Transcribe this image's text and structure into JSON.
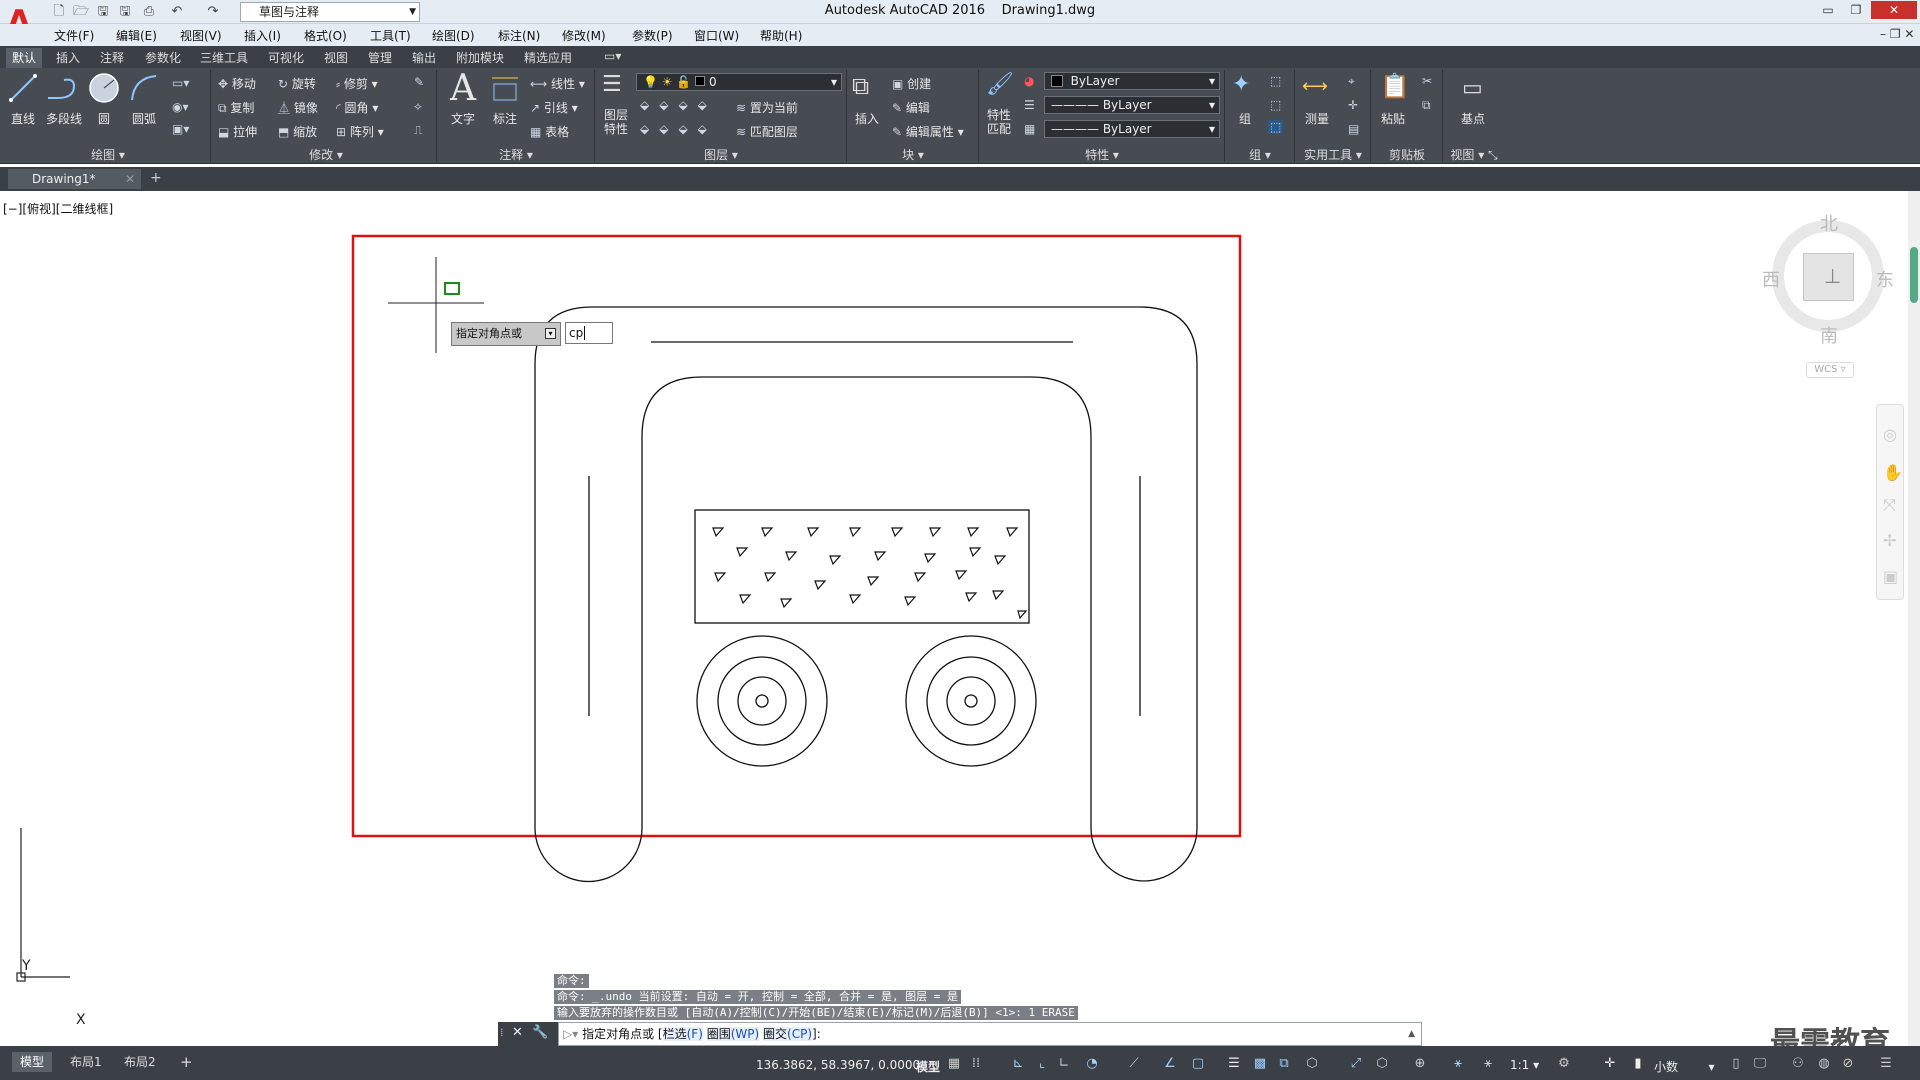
{
  "app": {
    "title": "Autodesk AutoCAD 2016",
    "file": "Drawing1.dwg"
  },
  "quick_access": {
    "workspace": "草图与注释"
  },
  "menu": [
    "文件(F)",
    "编辑(E)",
    "视图(V)",
    "插入(I)",
    "格式(O)",
    "工具(T)",
    "绘图(D)",
    "标注(N)",
    "修改(M)",
    "参数(P)",
    "窗口(W)",
    "帮助(H)"
  ],
  "ribbon_tabs": [
    "默认",
    "插入",
    "注释",
    "参数化",
    "三维工具",
    "可视化",
    "视图",
    "管理",
    "输出",
    "附加模块",
    "精选应用"
  ],
  "ribbon": {
    "draw": {
      "title": "绘图",
      "line": "直线",
      "polyline": "多段线",
      "circle": "圆",
      "arc": "圆弧"
    },
    "modify": {
      "title": "修改",
      "move": "移动",
      "rotate": "旋转",
      "trim": "修剪",
      "copy": "复制",
      "mirror": "镜像",
      "fillet": "圆角",
      "stretch": "拉伸",
      "scale": "缩放",
      "array": "阵列"
    },
    "annotation": {
      "title": "注释",
      "text": "文字",
      "dimension": "标注",
      "linear": "线性",
      "leader": "引线",
      "table": "表格"
    },
    "layers": {
      "title": "图层",
      "props": "图层特性",
      "layer_value": "0",
      "set_current": "置为当前",
      "match_layer": "匹配图层"
    },
    "block": {
      "title": "块",
      "insert": "插入",
      "create": "创建",
      "edit": "编辑",
      "edit_attr": "编辑属性"
    },
    "properties": {
      "title": "特性",
      "match": "特性匹配",
      "color": "ByLayer",
      "linetype": "ByLayer",
      "lineweight": "ByLayer"
    },
    "groups": {
      "title": "组",
      "group": "组"
    },
    "utilities": {
      "title": "实用工具",
      "measure": "测量"
    },
    "clipboard": {
      "title": "剪贴板",
      "paste": "粘贴"
    },
    "view": {
      "title": "视图",
      "base": "基点"
    }
  },
  "doc_tab": "Drawing1*",
  "viewport_label": "[−][俯视][二维线框]",
  "prompt": {
    "label": "指定对角点或",
    "input": "cp"
  },
  "viewcube": {
    "north": "北",
    "south": "南",
    "east": "东",
    "west": "西",
    "wcs": "WCS"
  },
  "ucs": {
    "x": "X",
    "y": "Y"
  },
  "command_history": [
    "命令:",
    "命令: _.undo 当前设置: 自动 = 开, 控制 = 全部, 合并 = 是, 图层 = 是",
    "输入要放弃的操作数目或 [自动(A)/控制(C)/开始(BE)/结束(E)/标记(M)/后退(B)] <1>: 1 ERASE"
  ],
  "command_line": {
    "prefix": "指定对角点或 [",
    "opt1": "栏选",
    "key1": "(F)",
    "opt2": "圈围",
    "key2": "(WP)",
    "opt3": "圈交",
    "key3": "(CP)",
    "suffix": "]:"
  },
  "layout_tabs": [
    "模型",
    "布局1",
    "布局2"
  ],
  "status": {
    "coords": "136.3862, 58.3967, 0.0000",
    "model": "模型",
    "scale": "1:1",
    "units": "小数"
  },
  "watermark": "最需教育",
  "colors": {
    "accent": "#d22222",
    "selection_frame": "#e01010",
    "ribbon_bg": "#474c53",
    "status_bg": "#3b4047"
  }
}
